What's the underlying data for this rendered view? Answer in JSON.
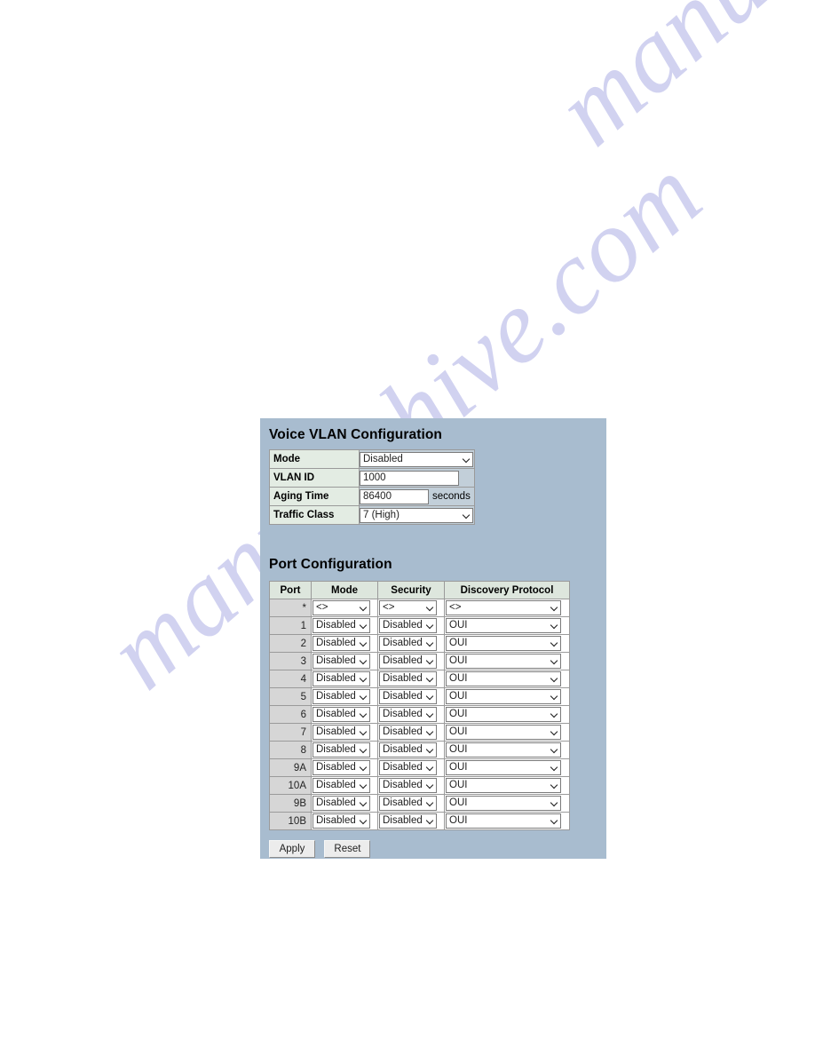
{
  "page": {
    "background": "#ffffff",
    "watermark_text": "manualshive.com",
    "watermark_color": "#c9cbee"
  },
  "panel": {
    "background": "#a8bccf"
  },
  "global_config": {
    "title": "Voice VLAN Configuration",
    "rows": [
      {
        "label": "Mode",
        "control": "select",
        "value": "Disabled"
      },
      {
        "label": "VLAN ID",
        "control": "text",
        "value": "1000"
      },
      {
        "label": "Aging Time",
        "control": "text",
        "value": "86400",
        "unit": "seconds"
      },
      {
        "label": "Traffic Class",
        "control": "select",
        "value": "7 (High)"
      }
    ]
  },
  "port_config": {
    "title": "Port Configuration",
    "headers": [
      "Port",
      "Mode",
      "Security",
      "Discovery Protocol"
    ],
    "rows": [
      {
        "port": "*",
        "mode": "<>",
        "security": "<>",
        "discovery": "<>"
      },
      {
        "port": "1",
        "mode": "Disabled",
        "security": "Disabled",
        "discovery": "OUI"
      },
      {
        "port": "2",
        "mode": "Disabled",
        "security": "Disabled",
        "discovery": "OUI"
      },
      {
        "port": "3",
        "mode": "Disabled",
        "security": "Disabled",
        "discovery": "OUI"
      },
      {
        "port": "4",
        "mode": "Disabled",
        "security": "Disabled",
        "discovery": "OUI"
      },
      {
        "port": "5",
        "mode": "Disabled",
        "security": "Disabled",
        "discovery": "OUI"
      },
      {
        "port": "6",
        "mode": "Disabled",
        "security": "Disabled",
        "discovery": "OUI"
      },
      {
        "port": "7",
        "mode": "Disabled",
        "security": "Disabled",
        "discovery": "OUI"
      },
      {
        "port": "8",
        "mode": "Disabled",
        "security": "Disabled",
        "discovery": "OUI"
      },
      {
        "port": "9A",
        "mode": "Disabled",
        "security": "Disabled",
        "discovery": "OUI"
      },
      {
        "port": "10A",
        "mode": "Disabled",
        "security": "Disabled",
        "discovery": "OUI"
      },
      {
        "port": "9B",
        "mode": "Disabled",
        "security": "Disabled",
        "discovery": "OUI"
      },
      {
        "port": "10B",
        "mode": "Disabled",
        "security": "Disabled",
        "discovery": "OUI"
      }
    ]
  },
  "buttons": {
    "apply_label": "Apply",
    "reset_label": "Reset"
  }
}
